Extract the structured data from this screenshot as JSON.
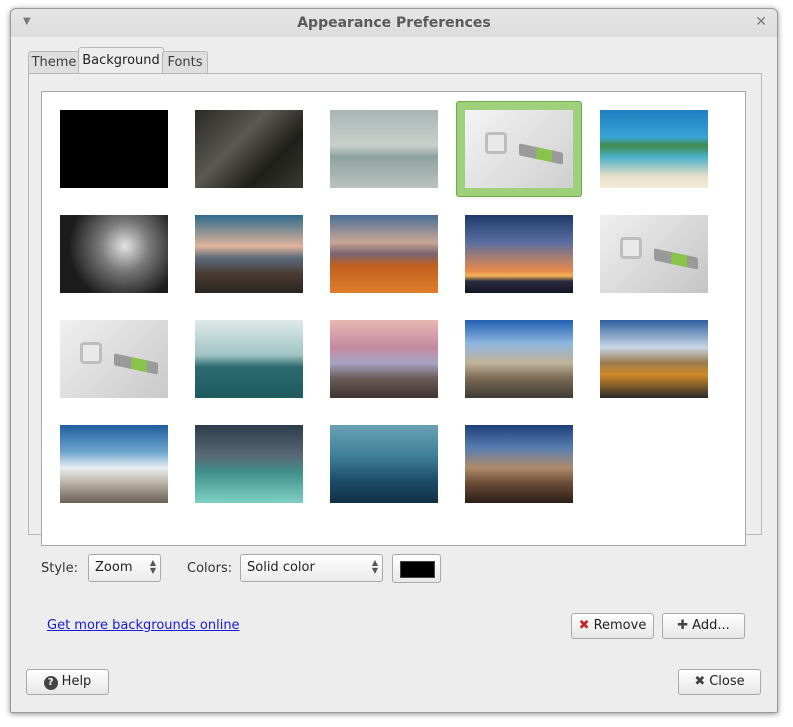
{
  "window": {
    "title": "Appearance Preferences",
    "menu_icon": "chevron-down-icon",
    "close_glyph": "✕"
  },
  "tabs": [
    {
      "label": "Theme",
      "active": false
    },
    {
      "label": "Background",
      "active": true
    },
    {
      "label": "Fonts",
      "active": false
    }
  ],
  "gallery": {
    "selected_index": 3,
    "thumbnails": [
      {
        "name": "solid-black",
        "bg": "#000000"
      },
      {
        "name": "dark-stone-wall",
        "bg": "linear-gradient(135deg,#2a2a26,#5a5850 40%,#1e1e1a 70%,#3a3a34)"
      },
      {
        "name": "lake-boat",
        "bg": "linear-gradient(#a9b5b4 0%,#c9d0cc 45%,#8fa29f 60%,#b9c4bf 100%)"
      },
      {
        "name": "mint-logo-white",
        "bg": "linear-gradient(135deg,#f4f4f4,#cfcfcf)"
      },
      {
        "name": "tropical-beach",
        "bg": "linear-gradient(#1d7fc0 0%,#3aa3d6 35%,#3f8a4a 45%,#49b0c9 60%,#e8dfc8 85%,#f3ecd8 100%)"
      },
      {
        "name": "waterfall",
        "bg": "radial-gradient(circle at 60% 40%,#e4e4e4,#7b7b7b 30%,#1c1c1c 70%)"
      },
      {
        "name": "mountain-sunset-desert",
        "bg": "linear-gradient(#2f6a8d 0%,#e0b49a 40%,#5b6a7a 55%,#4a3c33 75%,#2b241f 100%)"
      },
      {
        "name": "golden-field",
        "bg": "linear-gradient(#4a6f99 0%,#c9a795 35%,#7a6470 50%,#c0601f 65%,#e07d2a 100%)"
      },
      {
        "name": "ocean-sunset",
        "bg": "linear-gradient(#1f3a6b 0%,#5a6ea0 35%,#e98a4b 72%,#f3b35b 78%,#2b2b3f 85%,#101525 100%)"
      },
      {
        "name": "mint-logo-gray",
        "bg": "linear-gradient(135deg,#f0f0f0,#c5c5c5)"
      },
      {
        "name": "mint-logo-gray-2",
        "bg": "linear-gradient(135deg,#f0f0f0,#c9c9c9)"
      },
      {
        "name": "sea-island",
        "bg": "linear-gradient(#dfe9e8 0%,#9fc4c3 45%,#2c6b70 60%,#1f5a5f 100%)"
      },
      {
        "name": "pebble-beach-dusk",
        "bg": "linear-gradient(#e9b7b3 0%,#c48aa0 35%,#a7a3c2 55%,#6a5a58 75%,#3f332f 100%)"
      },
      {
        "name": "mountain-road-village",
        "bg": "linear-gradient(#1f5fb0 0%,#8fb6e0 30%,#c0b39a 55%,#7a6a55 75%,#3f3a34 100%)"
      },
      {
        "name": "desert-road",
        "bg": "linear-gradient(#2f5fa0 0%,#c9d6e6 35%,#9a7a4b 55%,#d08a2a 70%,#2a2a2a 100%)"
      },
      {
        "name": "salt-flat",
        "bg": "linear-gradient(#1f5f9f 0%,#6fa6cf 35%,#e9eef2 55%,#c7c0b3 70%,#6a6055 100%)"
      },
      {
        "name": "stormy-sea",
        "bg": "linear-gradient(#2c3b4a 0%,#5a6a78 40%,#3f8f8a 60%,#7fd0c4 100%)"
      },
      {
        "name": "boat-sea-teal",
        "bg": "linear-gradient(#6aa1b5 0%,#3f7f95 40%,#1f4f6b 70%,#0f2f45 100%)"
      },
      {
        "name": "mountain-desert-dusk",
        "bg": "linear-gradient(#1f3f7a 0%,#5a7fb0 30%,#b08a6a 55%,#6a4a35 75%,#2a1f18 100%)"
      }
    ]
  },
  "controls": {
    "style_label": "Style:",
    "style_value": "Zoom",
    "colors_label": "Colors:",
    "colors_value": "Solid color",
    "color_value": "#000000",
    "more_link": "Get more backgrounds online",
    "remove_label": "Remove",
    "remove_icon": "✖",
    "add_label": "Add...",
    "add_icon": "✚",
    "help_label": "Help",
    "help_icon": "?",
    "close_label": "Close",
    "close_icon": "✖"
  }
}
